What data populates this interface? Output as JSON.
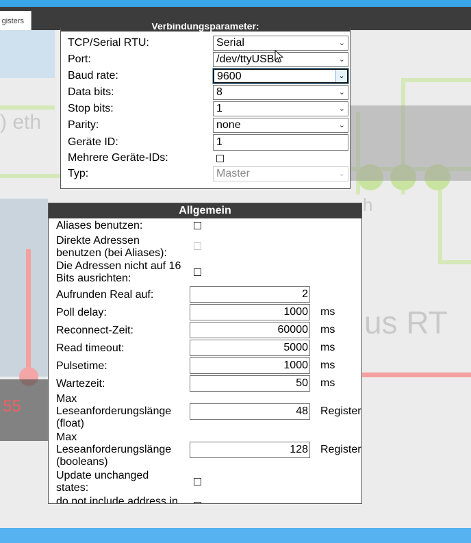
{
  "tab": {
    "label": "gisters"
  },
  "background": {
    "text1": ") eth",
    "text2": "h",
    "text3": "us RT",
    "text4": "55"
  },
  "connection": {
    "title": "Verbindungsparameter:",
    "rows": [
      {
        "label": "TCP/Serial RTU:",
        "value": "Serial",
        "type": "select"
      },
      {
        "label": "Port:",
        "value": "/dev/ttyUSB0",
        "type": "select"
      },
      {
        "label": "Baud rate:",
        "value": "9600",
        "type": "select-focus"
      },
      {
        "label": "Data bits:",
        "value": "8",
        "type": "select"
      },
      {
        "label": "Stop bits:",
        "value": "1",
        "type": "select"
      },
      {
        "label": "Parity:",
        "value": "none",
        "type": "select"
      },
      {
        "label": "Geräte ID:",
        "value": "1",
        "type": "input"
      },
      {
        "label": "Mehrere Geräte-IDs:",
        "value": false,
        "type": "checkbox"
      },
      {
        "label": "Typ:",
        "value": "Master",
        "type": "select-disabled"
      }
    ]
  },
  "general": {
    "title": "Allgemein",
    "aliases_label": "Aliases benutzen:",
    "aliases_checked": false,
    "direct_label_1": "Direkte Adressen",
    "direct_label_2": "benutzen (bei Aliases):",
    "direct_checked": false,
    "align_label_1": "Die Adressen nicht auf 16",
    "align_label_2": "Bits ausrichten:",
    "align_checked": false,
    "round_label": "Aufrunden Real auf:",
    "round_value": "2",
    "poll_label": "Poll delay:",
    "poll_value": "1000",
    "poll_unit": "ms",
    "reconnect_label": "Reconnect-Zeit:",
    "reconnect_value": "60000",
    "reconnect_unit": "ms",
    "readto_label": "Read timeout:",
    "readto_value": "5000",
    "readto_unit": "ms",
    "pulse_label": "Pulsetime:",
    "pulse_value": "1000",
    "pulse_unit": "ms",
    "wait_label": "Wartezeit:",
    "wait_value": "50",
    "wait_unit": "ms",
    "maxf_label_1": "Max",
    "maxf_label_2": "Leseanforderungslänge",
    "maxf_label_3": "(float)",
    "maxf_value": "48",
    "maxf_unit": "Register",
    "maxb_label_1": "Max",
    "maxb_label_2": "Leseanforderungslänge",
    "maxb_label_3": "(booleans)",
    "maxb_value": "128",
    "maxb_unit": "Register",
    "update_label_1": "Update unchanged",
    "update_label_2": "states:",
    "update_checked": false,
    "noaddr_label": "do not include address in"
  }
}
